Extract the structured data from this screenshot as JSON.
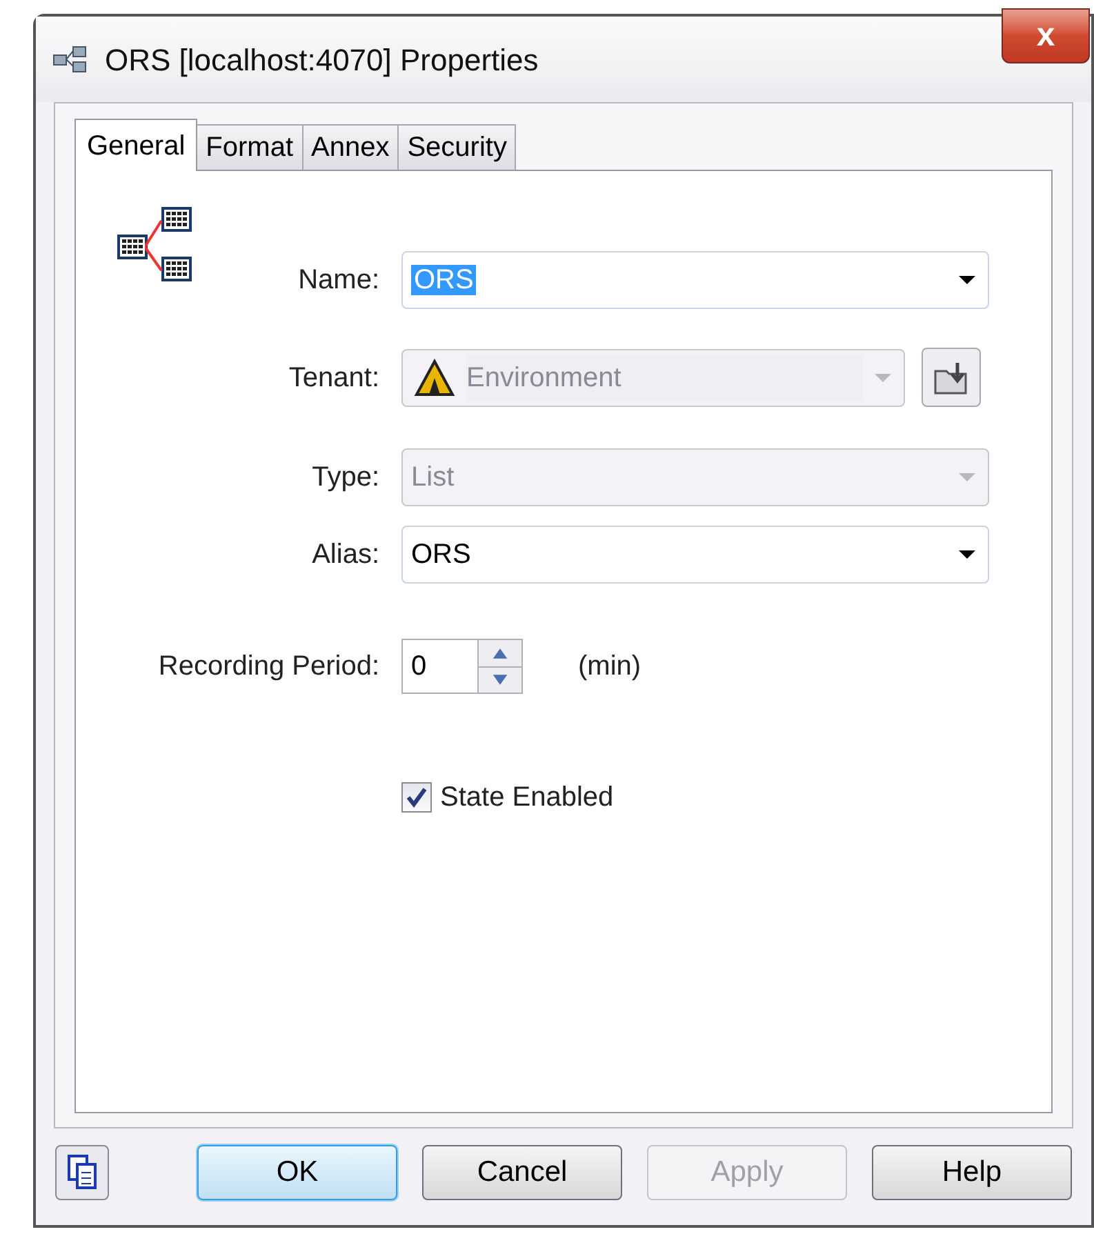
{
  "window": {
    "title": "ORS [localhost:4070] Properties",
    "close": "x"
  },
  "tabs": [
    {
      "label": "General",
      "selected": true
    },
    {
      "label": "Format",
      "selected": false
    },
    {
      "label": "Annex",
      "selected": false
    },
    {
      "label": "Security",
      "selected": false
    }
  ],
  "fields": [
    {
      "kind": "combo",
      "label": "Name:",
      "value": "ORS",
      "highlighted": true,
      "disabled": false
    },
    {
      "kind": "tenant",
      "label": "Tenant:",
      "value": "Environment",
      "disabled": true
    },
    {
      "kind": "combo",
      "label": "Type:",
      "value": "List",
      "highlighted": false,
      "disabled": true
    },
    {
      "kind": "combo",
      "label": "Alias:",
      "value": "ORS",
      "highlighted": false,
      "disabled": false
    }
  ],
  "recording_period": {
    "label": "Recording Period:",
    "value": "0",
    "unit": "(min)"
  },
  "state_enabled": {
    "label": "State Enabled",
    "checked": true
  },
  "buttons": [
    {
      "label": "OK",
      "default": true,
      "disabled": false
    },
    {
      "label": "Cancel",
      "default": false,
      "disabled": false
    },
    {
      "label": "Apply",
      "default": false,
      "disabled": true
    },
    {
      "label": "Help",
      "default": false,
      "disabled": false
    }
  ]
}
